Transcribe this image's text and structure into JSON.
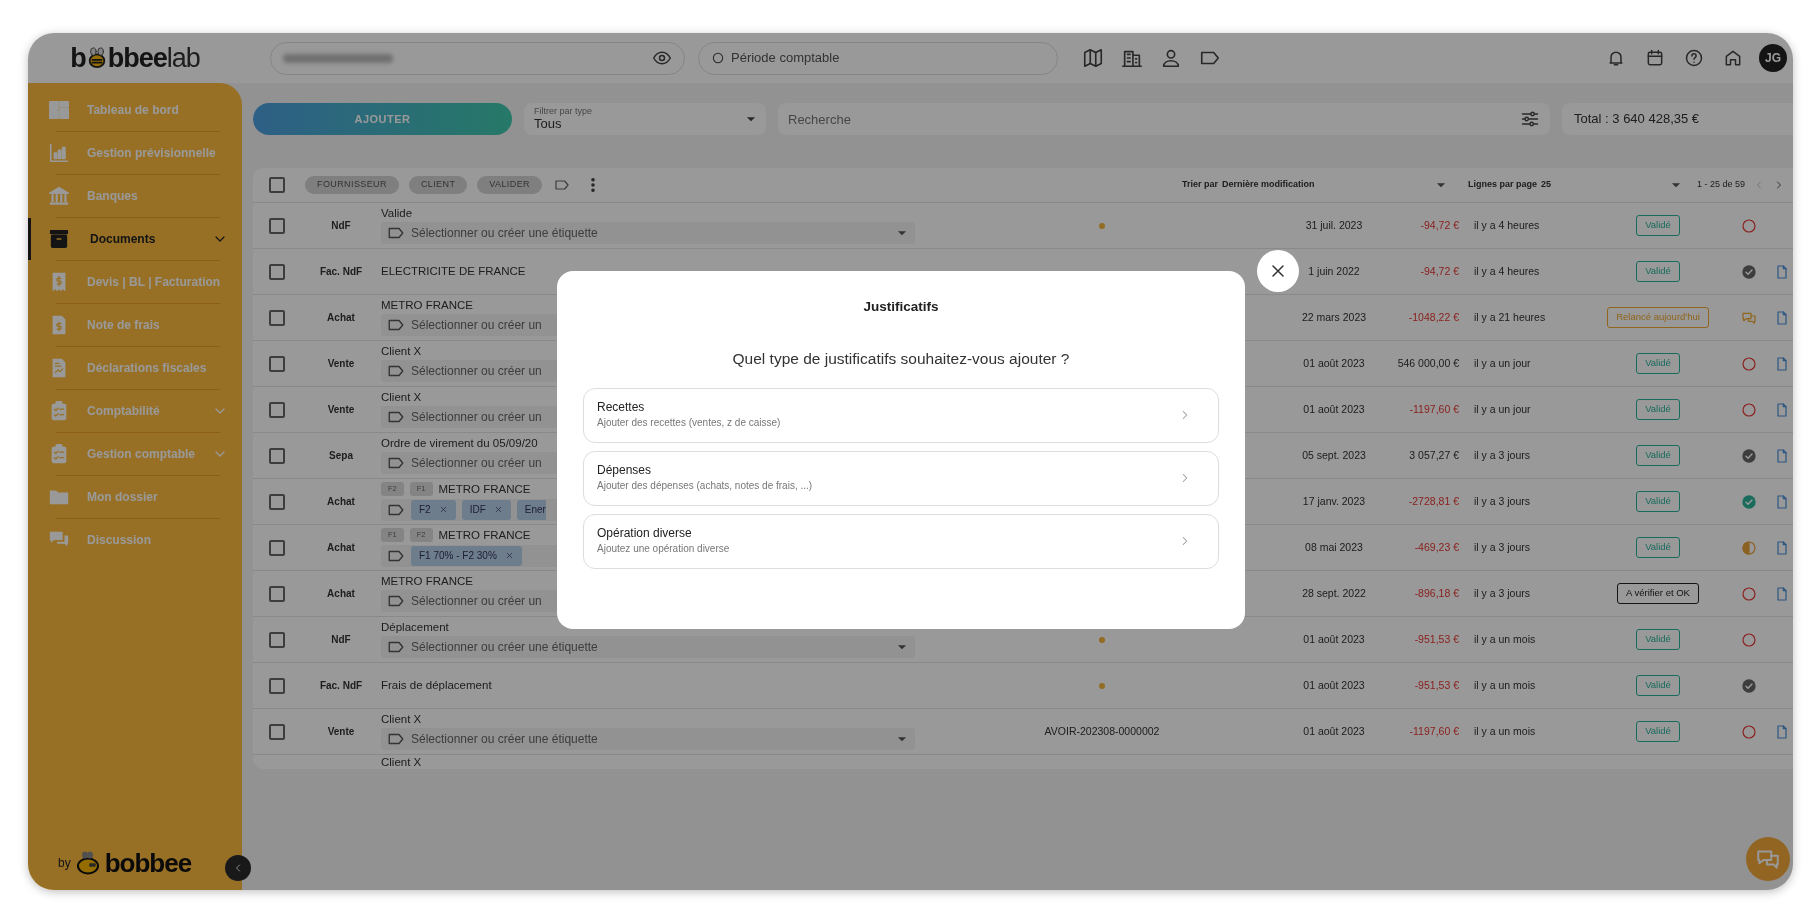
{
  "topbar": {
    "logo": {
      "start": "b",
      "middle": "bbee",
      "end": "lab"
    },
    "period_field": {
      "placeholder": "Période comptable"
    },
    "avatar": "JG"
  },
  "sidebar": {
    "items": [
      {
        "label": "Tableau de bord",
        "selected": false,
        "expandable": false
      },
      {
        "label": "Gestion prévisionnelle",
        "selected": false,
        "expandable": false
      },
      {
        "label": "Banques",
        "selected": false,
        "expandable": false
      },
      {
        "label": "Documents",
        "selected": true,
        "expandable": true
      },
      {
        "label": "Devis | BL | Facturation",
        "selected": false,
        "expandable": false
      },
      {
        "label": "Note de frais",
        "selected": false,
        "expandable": false
      },
      {
        "label": "Déclarations fiscales",
        "selected": false,
        "expandable": false
      },
      {
        "label": "Comptabilité",
        "selected": false,
        "expandable": true
      },
      {
        "label": "Gestion comptable",
        "selected": false,
        "expandable": true
      },
      {
        "label": "Mon dossier",
        "selected": false,
        "expandable": false
      },
      {
        "label": "Discussion",
        "selected": false,
        "expandable": false
      }
    ],
    "footer": {
      "by": "by",
      "brand": "bobbee"
    }
  },
  "toolbar": {
    "add_button": "AJOUTER",
    "filter": {
      "label": "Filtrer par type",
      "value": "Tous"
    },
    "search": {
      "placeholder": "Recherche"
    },
    "total": "Total : 3 640 428,35 €"
  },
  "table": {
    "select_all_checked": false,
    "filters": [
      "FOURNISSEUR",
      "CLIENT",
      "VALIDER"
    ],
    "sort": {
      "label": "Trier par",
      "value": "Dernière modification"
    },
    "per_page": {
      "label": "Lignes par page",
      "value": "25"
    },
    "pagination": "1 - 25 de 59",
    "rows": [
      {
        "kind": "full",
        "checked": false,
        "type": "NdF",
        "title": "Valide",
        "field": {
          "placeholder": "Sélectionner ou créer une étiquette",
          "dropdown": true
        },
        "flagged": true,
        "date": "31 juil. 2023",
        "amount": "-94,72 €",
        "negative": true,
        "time": "il y a 4 heures",
        "status_badge": {
          "text": "Validé",
          "kind": "validated"
        },
        "progress_icon": {
          "kind": "todo"
        },
        "document": false
      },
      {
        "kind": "full",
        "checked": false,
        "type": "Fac. NdF",
        "title": "ELECTRICITE DE FRANCE",
        "flagged": false,
        "date": "1 juin 2022",
        "amount": "-94,72 €",
        "negative": true,
        "time": "il y a 4 heures",
        "status_badge": {
          "text": "Validé",
          "kind": "validated"
        },
        "progress_icon": {
          "kind": "done"
        },
        "document": true
      },
      {
        "kind": "full",
        "checked": false,
        "type": "Achat",
        "title": "METRO FRANCE",
        "field": {
          "placeholder": "Sélectionner ou créer un",
          "dropdown": false
        },
        "flagged": false,
        "date": "22 mars 2023",
        "amount": "-1048,22 €",
        "negative": true,
        "time": "il y a 21 heures",
        "status_badge": {
          "text": "Relancé aujourd'hui",
          "kind": "reminded"
        },
        "progress_icon": {
          "kind": "comment"
        },
        "document": true
      },
      {
        "kind": "full",
        "checked": false,
        "type": "Vente",
        "title": "Client X",
        "field": {
          "placeholder": "Sélectionner ou créer un",
          "dropdown": false
        },
        "flagged": false,
        "date": "01 août 2023",
        "amount": "546 000,00 €",
        "negative": false,
        "time": "il y a un jour",
        "status_badge": {
          "text": "Validé",
          "kind": "validated"
        },
        "progress_icon": {
          "kind": "todo"
        },
        "document": true
      },
      {
        "kind": "full",
        "checked": false,
        "type": "Vente",
        "title": "Client X",
        "field": {
          "placeholder": "Sélectionner ou créer un",
          "dropdown": false
        },
        "flagged": false,
        "date": "01 août 2023",
        "amount": "-1197,60 €",
        "negative": true,
        "time": "il y a un jour",
        "status_badge": {
          "text": "Validé",
          "kind": "validated"
        },
        "progress_icon": {
          "kind": "todo"
        },
        "document": true
      },
      {
        "kind": "full",
        "checked": false,
        "type": "Sepa",
        "title": "Ordre de virement du 05/09/20",
        "field": {
          "placeholder": "Sélectionner ou créer un",
          "dropdown": false
        },
        "flagged": false,
        "date": "05 sept. 2023",
        "amount": "3 057,27 €",
        "negative": false,
        "time": "il y a 3 jours",
        "status_badge": {
          "text": "Validé",
          "kind": "validated"
        },
        "progress_icon": {
          "kind": "done"
        },
        "document": true
      },
      {
        "kind": "full",
        "checked": false,
        "type": "Achat",
        "codes": [
          "F2",
          "F1"
        ],
        "title": "METRO FRANCE",
        "field": {
          "tags": [
            {
              "label": "F2",
              "removable": true
            },
            {
              "label": "IDF",
              "removable": true
            },
            {
              "label": "Ener",
              "removable": false
            }
          ],
          "dropdown": false
        },
        "flagged": false,
        "date": "17 janv. 2023",
        "amount": "-2728,81 €",
        "negative": true,
        "time": "il y a 3 jours",
        "status_badge": {
          "text": "Validé",
          "kind": "validated"
        },
        "progress_icon": {
          "kind": "verified"
        },
        "document": true
      },
      {
        "kind": "full",
        "checked": false,
        "type": "Achat",
        "codes": [
          "F1",
          "F2"
        ],
        "title": "METRO FRANCE",
        "field": {
          "tags": [
            {
              "label": "F1 70% - F2 30%",
              "removable": true
            }
          ],
          "dropdown": false
        },
        "flagged": false,
        "date": "08 mai 2023",
        "amount": "-469,23 €",
        "negative": true,
        "time": "il y a 3 jours",
        "status_badge": {
          "text": "Validé",
          "kind": "validated"
        },
        "progress_icon": {
          "kind": "partial"
        },
        "document": true
      },
      {
        "kind": "full",
        "checked": false,
        "type": "Achat",
        "title": "METRO FRANCE",
        "field": {
          "placeholder": "Sélectionner ou créer un",
          "dropdown": false
        },
        "flagged": false,
        "date": "28 sept. 2022",
        "amount": "-896,18 €",
        "negative": true,
        "time": "il y a 3 jours",
        "status_badge": {
          "text": "A vérifier et OK",
          "kind": "review"
        },
        "progress_icon": {
          "kind": "todo"
        },
        "document": true
      },
      {
        "kind": "full",
        "checked": false,
        "type": "NdF",
        "title": "Déplacement",
        "field": {
          "placeholder": "Sélectionner ou créer une étiquette",
          "dropdown": true
        },
        "flagged": true,
        "date": "01 août 2023",
        "amount": "-951,53 €",
        "negative": true,
        "time": "il y a un mois",
        "status_badge": {
          "text": "Validé",
          "kind": "validated"
        },
        "progress_icon": {
          "kind": "todo"
        },
        "document": false
      },
      {
        "kind": "full",
        "checked": false,
        "type": "Fac. NdF",
        "title": "Frais de déplacement",
        "flagged": true,
        "date": "01 août 2023",
        "amount": "-951,53 €",
        "negative": true,
        "time": "il y a un mois",
        "status_badge": {
          "text": "Validé",
          "kind": "validated"
        },
        "progress_icon": {
          "kind": "done"
        },
        "document": false
      },
      {
        "kind": "full",
        "checked": false,
        "type": "Vente",
        "title": "Client X",
        "field": {
          "placeholder": "Sélectionner ou créer une étiquette",
          "dropdown": true
        },
        "flagged": false,
        "reference": "AVOIR-202308-0000002",
        "date": "01 août 2023",
        "amount": "-1197,60 €",
        "negative": true,
        "time": "il y a un mois",
        "status_badge": {
          "text": "Validé",
          "kind": "validated"
        },
        "progress_icon": {
          "kind": "todo"
        },
        "document": true
      },
      {
        "kind": "partial",
        "title": "Client X"
      }
    ]
  },
  "modal": {
    "title": "Justificatifs",
    "question": "Quel type de justificatifs souhaitez-vous ajouter ?",
    "options": [
      {
        "title": "Recettes",
        "subtitle": "Ajouter des recettes (ventes, z de caisse)"
      },
      {
        "title": "Dépenses",
        "subtitle": "Ajouter des dépenses (achats, notes de frais, ...)"
      },
      {
        "title": "Opération diverse",
        "subtitle": "Ajoutez une opération diverse"
      }
    ]
  }
}
